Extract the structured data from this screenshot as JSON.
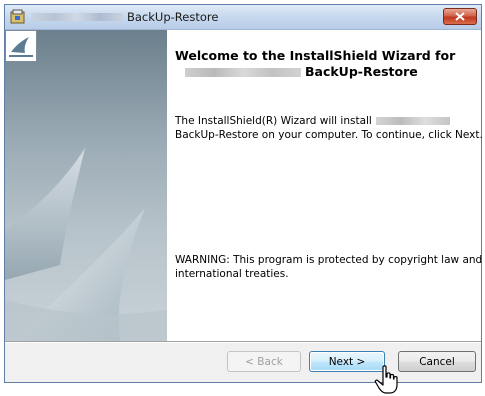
{
  "window": {
    "title": "BackUp-Restore"
  },
  "content": {
    "heading_line1": "Welcome to the InstallShield Wizard for",
    "heading_line2": "BackUp-Restore",
    "body_line1": "The InstallShield(R) Wizard will install",
    "body_line2": "BackUp-Restore on your computer. To continue, click Next.",
    "warning_line1": "WARNING: This program is protected by copyright law and",
    "warning_line2": "international treaties."
  },
  "buttons": {
    "back": "< Back",
    "next": "Next >",
    "cancel": "Cancel"
  },
  "icons": {
    "title": "installer-icon",
    "close": "close-icon",
    "logo": "sail-logo-icon",
    "cursor": "mouse-pointer-icon"
  },
  "colors": {
    "close_button": "#c0391f",
    "next_button_border": "#3c7fb1",
    "banner_top": "#6b7f8c"
  }
}
